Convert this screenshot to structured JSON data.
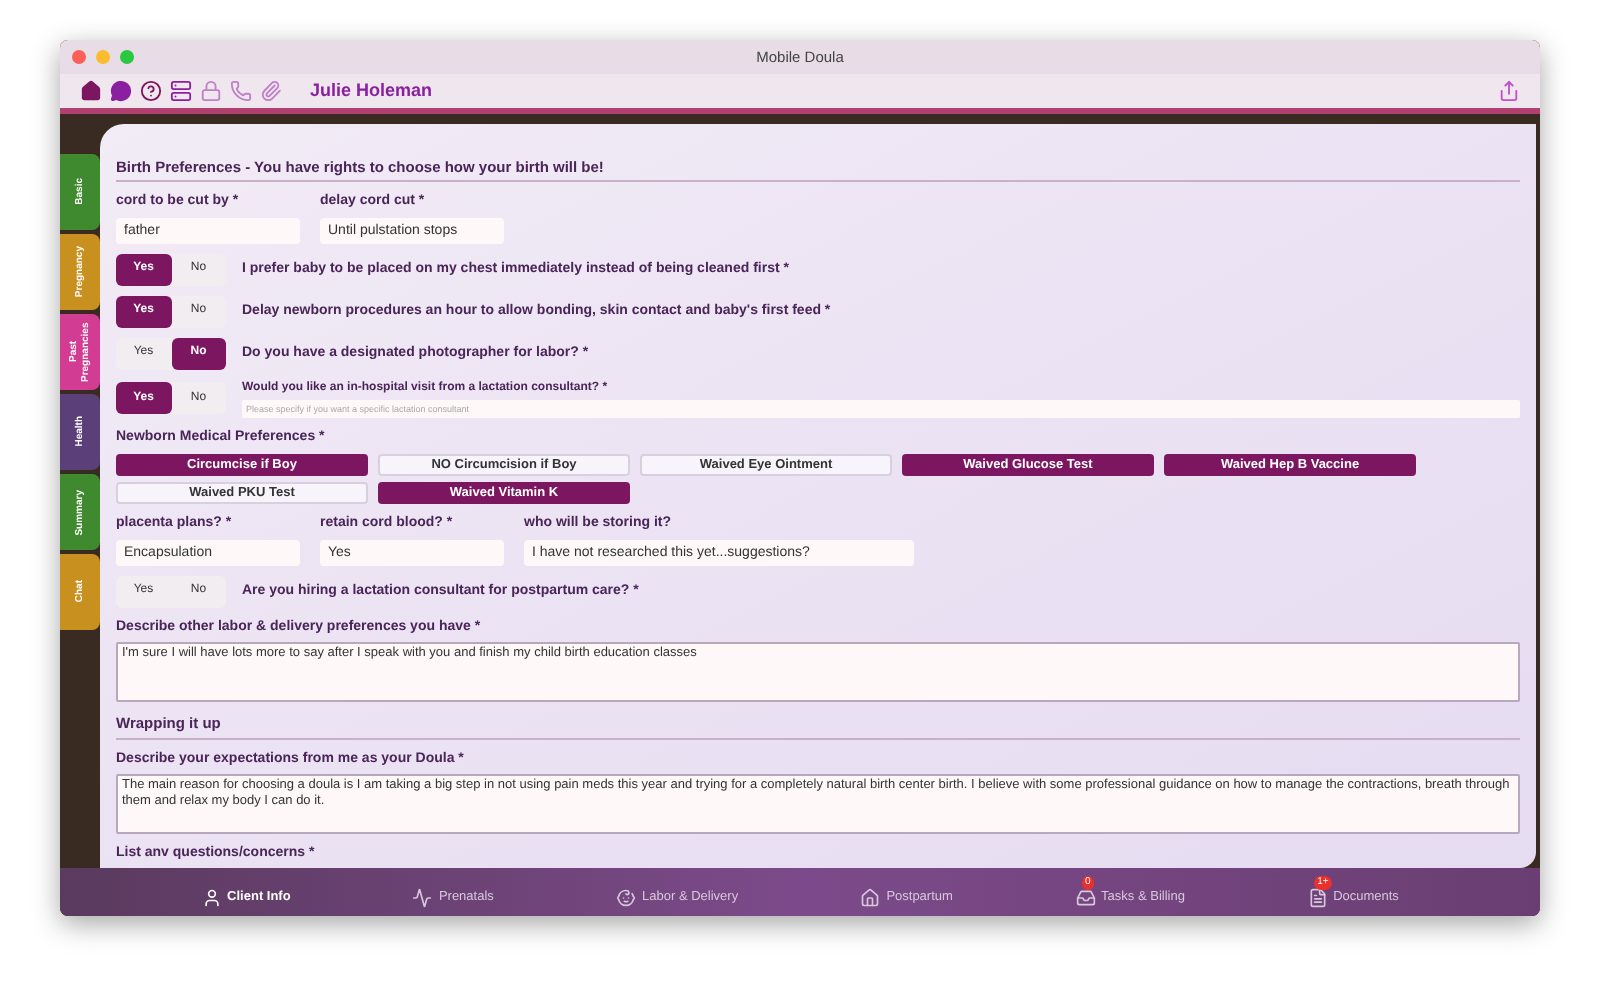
{
  "window": {
    "title": "Mobile Doula"
  },
  "toolbar": {
    "client_name": "Julie Holeman"
  },
  "side_tabs": [
    {
      "label": "Basic",
      "color": "#3f8a2e"
    },
    {
      "label": "Pregnancy",
      "color": "#c8901e"
    },
    {
      "label": "Past Pregnancies",
      "color": "#d23c93"
    },
    {
      "label": "Health",
      "color": "#5b3f78"
    },
    {
      "label": "Summary",
      "color": "#3f8a2e"
    },
    {
      "label": "Chat",
      "color": "#c8901e"
    }
  ],
  "sections": [
    {
      "title": "Birth Preferences - You have rights to choose how your birth will be!",
      "rows": [
        {
          "kind": "fields",
          "fields": [
            {
              "label": "cord to be cut by *",
              "value": "father"
            },
            {
              "label": "delay cord cut *",
              "value": "Until pulstation stops"
            }
          ]
        },
        {
          "kind": "toggle",
          "question": "I prefer baby to be placed on my chest immediately instead of being cleaned first *",
          "options": [
            {
              "label": "Yes",
              "selected": true
            },
            {
              "label": "No",
              "selected": false
            }
          ]
        },
        {
          "kind": "toggle",
          "question": "Delay newborn procedures an hour to allow bonding, skin contact and baby's first feed *",
          "options": [
            {
              "label": "Yes",
              "selected": true
            },
            {
              "label": "No",
              "selected": false
            }
          ]
        },
        {
          "kind": "toggle",
          "question": "Do you have a designated photographer for labor? *",
          "options": [
            {
              "label": "Yes",
              "selected": false
            },
            {
              "label": "No",
              "selected": true
            }
          ]
        },
        {
          "kind": "toggle_field",
          "question": "Would you like an in-hospital visit from a lactation consultant? *",
          "placeholder": "Please specify if you want a specific lactation consultant",
          "options": [
            {
              "label": "Yes",
              "selected": true
            },
            {
              "label": "No",
              "selected": false
            }
          ]
        },
        {
          "kind": "choices",
          "label": "Newborn Medical Preferences *",
          "options": [
            {
              "label": "Circumcise if Boy",
              "selected": true
            },
            {
              "label": "NO Circumcision if Boy",
              "selected": false
            },
            {
              "label": "Waived Eye Ointment",
              "selected": false
            },
            {
              "label": "Waived Glucose Test",
              "selected": true
            },
            {
              "label": "Waived Hep B Vaccine",
              "selected": true
            },
            {
              "label": "Waived PKU Test",
              "selected": false
            },
            {
              "label": "Waived Vitamin K",
              "selected": true
            }
          ]
        },
        {
          "kind": "fields",
          "fields": [
            {
              "label": "placenta plans? *",
              "value": "Encapsulation"
            },
            {
              "label": "retain cord blood? *",
              "value": "Yes"
            },
            {
              "label": "who will be storing it?",
              "value": "I have not researched this yet...suggestions?"
            }
          ]
        },
        {
          "kind": "toggle",
          "question": "Are you hiring a lactation consultant for postpartum care? *",
          "options": [
            {
              "label": "Yes",
              "selected": false
            },
            {
              "label": "No",
              "selected": false
            }
          ]
        },
        {
          "kind": "textarea",
          "label": "Describe other labor & delivery preferences you have *",
          "value": "I'm sure I will have lots more to say after I speak with you and finish my child birth education classes"
        }
      ]
    },
    {
      "title": "Wrapping it up",
      "rows": [
        {
          "kind": "textarea",
          "label": "Describe your expectations from me as your Doula *",
          "value": "The main reason for choosing a doula is I am taking a big step in not using pain meds this year and trying for a completely natural birth center birth.  I believe with some professional guidance on how to manage the contractions, breath through them and relax my body I can do it."
        },
        {
          "kind": "label",
          "label": "List anv questions/concerns *"
        }
      ]
    }
  ],
  "bottom_tabs": [
    {
      "label": "Client Info",
      "selected": true
    },
    {
      "label": "Prenatals",
      "selected": false
    },
    {
      "label": "Labor & Delivery",
      "selected": false
    },
    {
      "label": "Postpartum",
      "selected": false
    },
    {
      "label": "Tasks & Billing",
      "selected": false,
      "badge": "0"
    },
    {
      "label": "Documents",
      "selected": false,
      "badge": "1+"
    }
  ]
}
